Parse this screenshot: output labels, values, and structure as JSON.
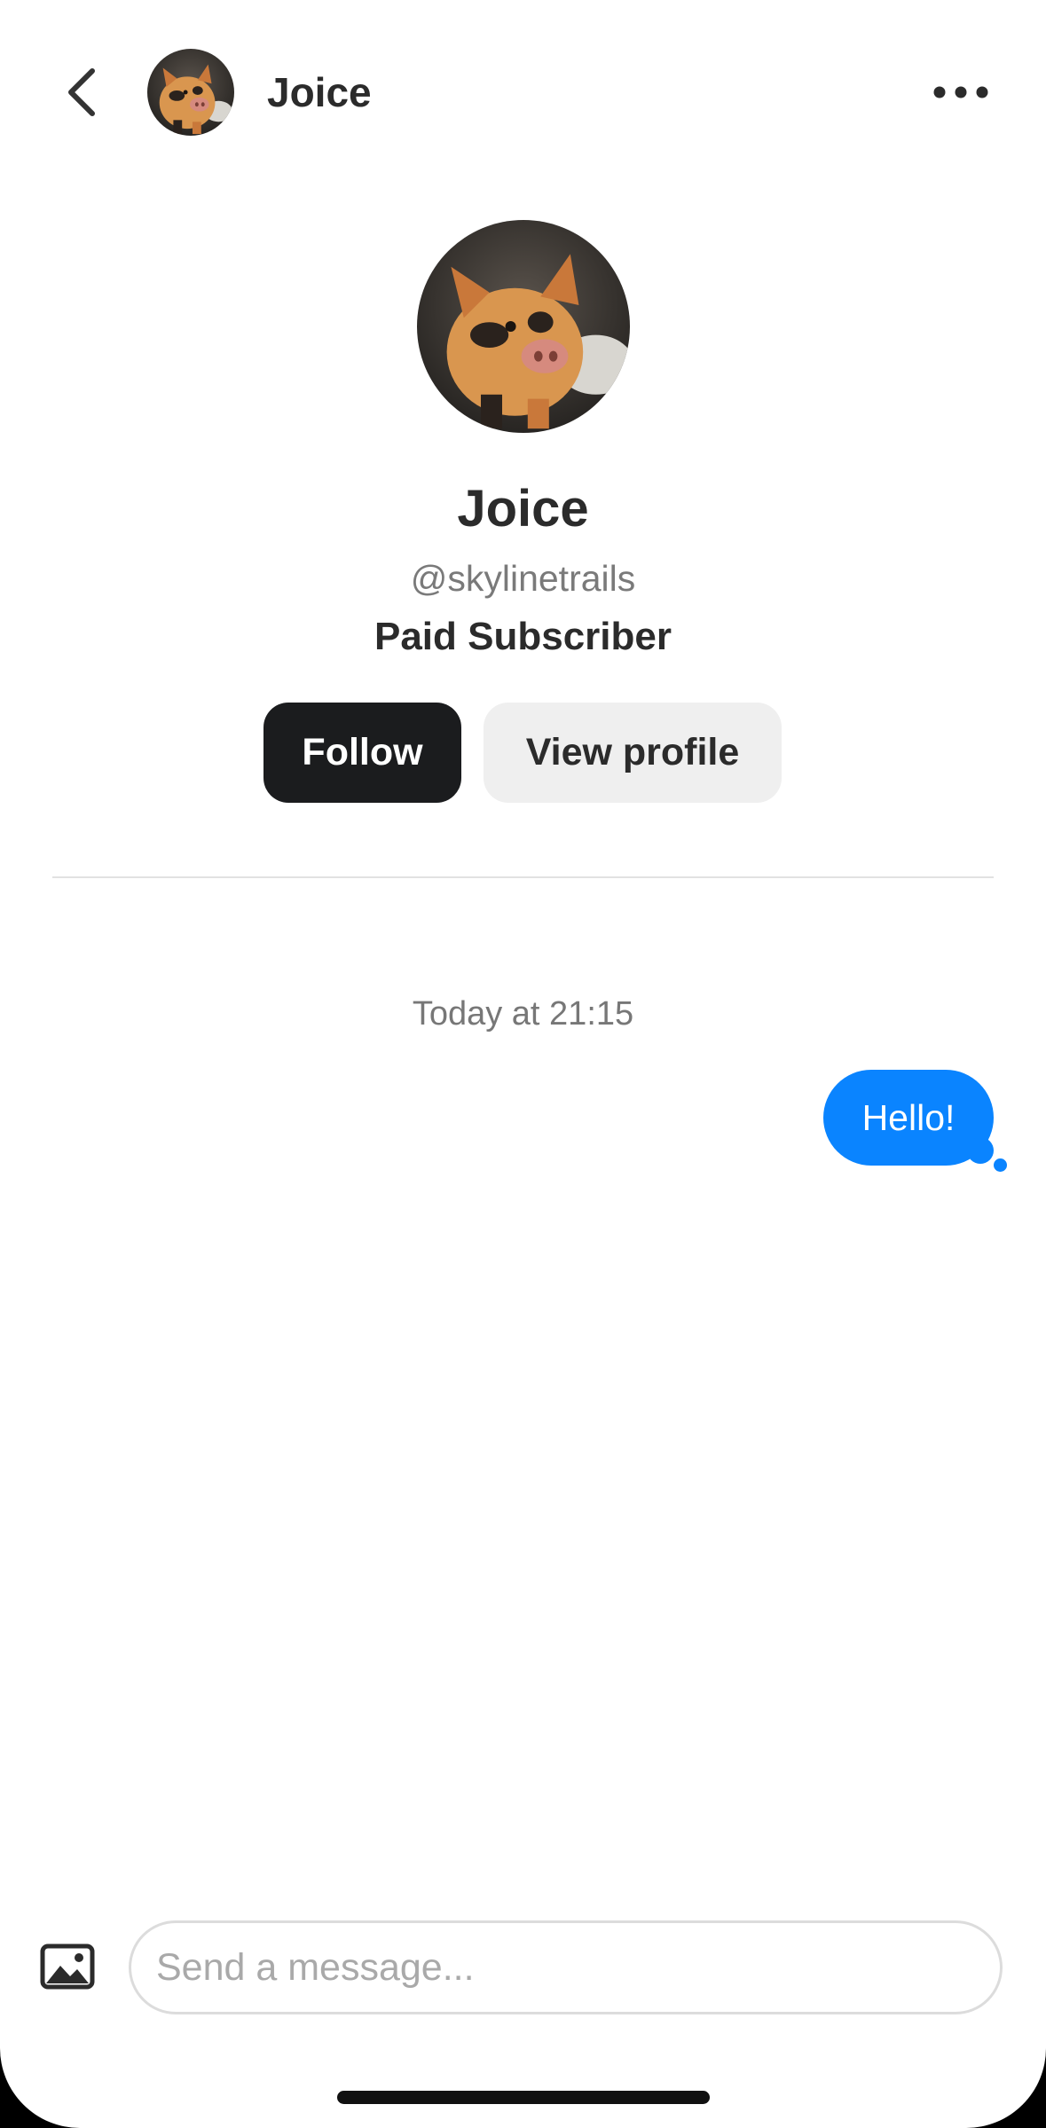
{
  "header": {
    "contact_name": "Joice",
    "back_icon": "chevron-left-icon",
    "more_icon": "ellipsis-icon"
  },
  "profile": {
    "name": "Joice",
    "handle": "@skylinetrails",
    "status": "Paid Subscriber",
    "avatar_subject": "piglet"
  },
  "actions": {
    "follow_label": "Follow",
    "view_profile_label": "View profile"
  },
  "conversation": {
    "timestamp": "Today at 21:15",
    "messages": [
      {
        "text": "Hello!",
        "sender": "me"
      }
    ]
  },
  "composer": {
    "placeholder": "Send a message...",
    "value": "",
    "image_icon": "image-icon"
  },
  "colors": {
    "accent": "#0a84ff",
    "follow_button_bg": "#1b1c1e",
    "secondary_button_bg": "#efefef",
    "text_primary": "#2b2b2b",
    "text_secondary": "#777777"
  }
}
